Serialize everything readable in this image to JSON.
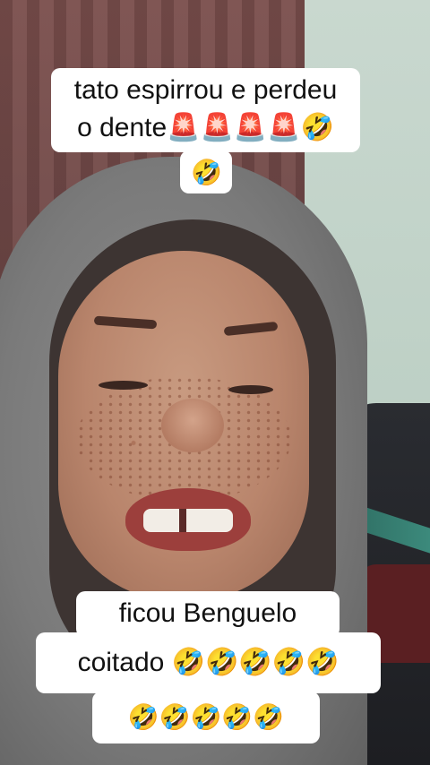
{
  "captions": {
    "top_line1": "tato espirrou e perdeu",
    "top_line2": "o dente🚨🚨🚨🚨🤣",
    "top_line3": "🤣",
    "bottom_line1": "ficou Benguelo",
    "bottom_line2": "coitado 🤣🤣🤣🤣🤣",
    "bottom_line3": "🤣🤣🤣🤣🤣"
  },
  "colors": {
    "caption_background": "#ffffff",
    "caption_text": "#111111",
    "hoodie": "#7a7a7a",
    "curtain": "#6e4746",
    "wall": "#bccfc4"
  }
}
